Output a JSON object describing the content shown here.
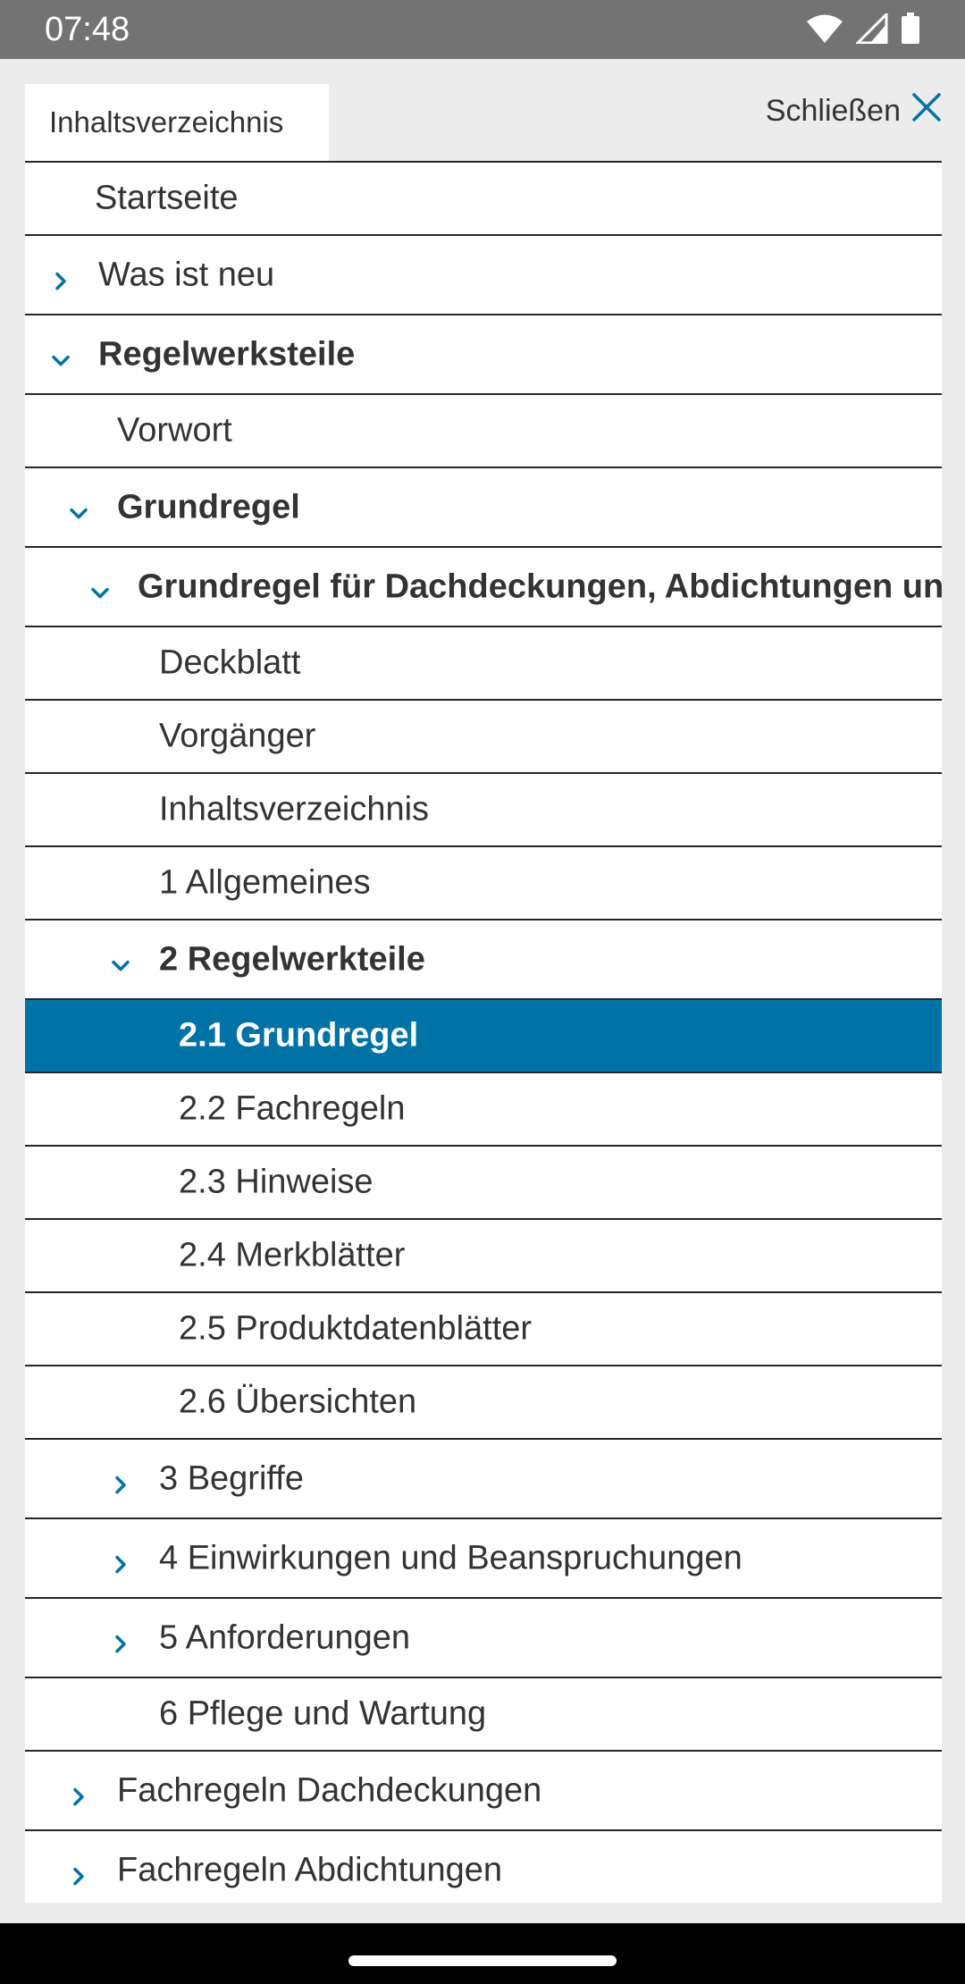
{
  "status_bar": {
    "time": "07:48",
    "icons": [
      "wifi-icon",
      "signal-icon",
      "battery-icon"
    ]
  },
  "colors": {
    "accent": "#0073a6",
    "text": "#333333",
    "border": "#262626"
  },
  "tab": {
    "label": "Inhaltsverzeichnis"
  },
  "close": {
    "label": "Schließen",
    "icon": "close-icon"
  },
  "toc": [
    {
      "label": "Startseite",
      "expander": "none",
      "selected": false
    },
    {
      "label": "Was ist neu",
      "expander": "chevron-right-icon",
      "selected": false
    },
    {
      "label": "Regelwerksteile",
      "expander": "chevron-down-icon",
      "selected": false
    },
    {
      "label": "Vorwort",
      "expander": "none",
      "selected": false
    },
    {
      "label": "Grundregel",
      "expander": "chevron-down-icon",
      "selected": false
    },
    {
      "label": "Grundregel für Dachdeckungen, Abdichtungen und Außenwandbekleidungen",
      "expander": "chevron-down-icon",
      "selected": false
    },
    {
      "label": "Deckblatt",
      "expander": "none",
      "selected": false
    },
    {
      "label": "Vorgänger",
      "expander": "none",
      "selected": false
    },
    {
      "label": "Inhaltsverzeichnis",
      "expander": "none",
      "selected": false
    },
    {
      "label": "1 Allgemeines",
      "expander": "none",
      "selected": false
    },
    {
      "label": "2  Regelwerkteile",
      "expander": "chevron-down-icon",
      "selected": false
    },
    {
      "label": "2.1 Grundregel",
      "expander": "none",
      "selected": true
    },
    {
      "label": "2.2 Fachregeln",
      "expander": "none",
      "selected": false
    },
    {
      "label": "2.3 Hinweise",
      "expander": "none",
      "selected": false
    },
    {
      "label": "2.4 Merkblätter",
      "expander": "none",
      "selected": false
    },
    {
      "label": "2.5 Produktdatenblätter",
      "expander": "none",
      "selected": false
    },
    {
      "label": "2.6 Übersichten",
      "expander": "none",
      "selected": false
    },
    {
      "label": "3  Begriffe",
      "expander": "chevron-right-icon",
      "selected": false
    },
    {
      "label": "4  Einwirkungen und Beanspruchungen",
      "expander": "chevron-right-icon",
      "selected": false
    },
    {
      "label": "5  Anforderungen",
      "expander": "chevron-right-icon",
      "selected": false
    },
    {
      "label": "6 Pflege und Wartung",
      "expander": "none",
      "selected": false
    },
    {
      "label": "Fachregeln Dachdeckungen",
      "expander": "chevron-right-icon",
      "selected": false
    },
    {
      "label": "Fachregeln Abdichtungen",
      "expander": "chevron-right-icon",
      "selected": false
    }
  ]
}
